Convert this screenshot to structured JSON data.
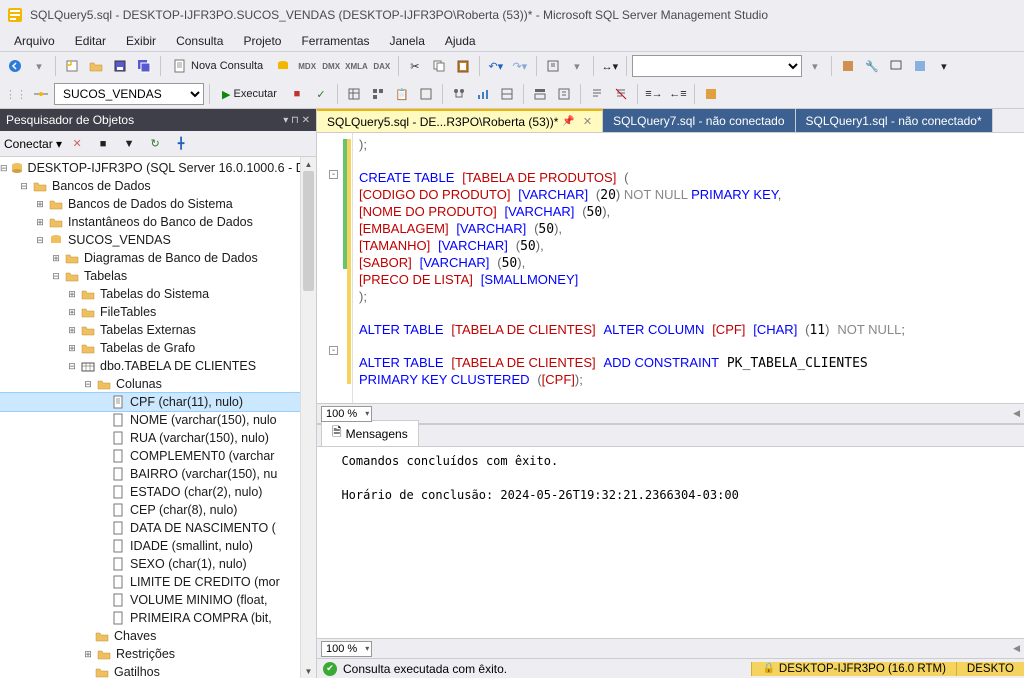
{
  "title": "SQLQuery5.sql - DESKTOP-IJFR3PO.SUCOS_VENDAS (DESKTOP-IJFR3PO\\Roberta (53))* - Microsoft SQL Server Management Studio",
  "menu": [
    "Arquivo",
    "Editar",
    "Exibir",
    "Consulta",
    "Projeto",
    "Ferramentas",
    "Janela",
    "Ajuda"
  ],
  "toolbar": {
    "nova_consulta": "Nova Consulta",
    "executar": "Executar"
  },
  "db_dropdown": "SUCOS_VENDAS",
  "object_explorer": {
    "title": "Pesquisador de Objetos",
    "connect": "Conectar",
    "server": "DESKTOP-IJFR3PO (SQL Server 16.0.1000.6 - DES",
    "bancos": "Bancos de Dados",
    "sys_db": "Bancos de Dados do Sistema",
    "snapshots": "Instantâneos do Banco de Dados",
    "db": "SUCOS_VENDAS",
    "diagramas": "Diagramas de Banco de Dados",
    "tabelas": "Tabelas",
    "tabelas_sistema": "Tabelas do Sistema",
    "filetables": "FileTables",
    "tabelas_externas": "Tabelas Externas",
    "tabelas_grafo": "Tabelas de Grafo",
    "tabela_clientes": "dbo.TABELA DE CLIENTES",
    "colunas": "Colunas",
    "cols": [
      "CPF (char(11), nulo)",
      "NOME (varchar(150), nulo",
      "RUA (varchar(150), nulo)",
      "COMPLEMENT0 (varchar",
      "BAIRRO (varchar(150), nu",
      "ESTADO (char(2), nulo)",
      "CEP (char(8), nulo)",
      "DATA DE NASCIMENTO (",
      "IDADE (smallint, nulo)",
      "SEXO (char(1), nulo)",
      "LIMITE DE CREDITO (mor",
      "VOLUME MINIMO (float,",
      "PRIMEIRA COMPRA (bit,"
    ],
    "chaves": "Chaves",
    "restricoes": "Restrições",
    "gatilhos": "Gatilhos"
  },
  "tabs": [
    {
      "label": "SQLQuery5.sql - DE...R3PO\\Roberta (53))*",
      "active": true,
      "modified": true
    },
    {
      "label": "SQLQuery7.sql - não conectado",
      "active": false
    },
    {
      "label": "SQLQuery1.sql - não conectado*",
      "active": false
    }
  ],
  "sql": {
    "lines": [
      {
        "t": ");",
        "indent": 2
      },
      {
        "t": "",
        "indent": 0
      },
      {
        "type": "create",
        "indent": 0
      },
      {
        "col": "CODIGO DO PRODUTO",
        "vt": "VARCHAR",
        "len": "20",
        "tail": "NOT NULL",
        "pk": true,
        "comma": ","
      },
      {
        "col": "NOME DO PRODUTO",
        "vt": "VARCHAR",
        "len": "50",
        "comma": ","
      },
      {
        "col": "EMBALAGEM",
        "vt": "VARCHAR",
        "len": "50",
        "comma": ","
      },
      {
        "col": "TAMANHO",
        "vt": "VARCHAR",
        "len": "50",
        "comma": ","
      },
      {
        "col": "SABOR",
        "vt": "VARCHAR",
        "len": "50",
        "comma": ","
      },
      {
        "col": "PRECO DE LISTA",
        "vt": "SMALLMONEY"
      },
      {
        "t": ");",
        "indent": 2
      },
      {
        "t": "",
        "indent": 0
      },
      {
        "type": "alter1"
      },
      {
        "t": "",
        "indent": 0
      },
      {
        "type": "alter2a"
      },
      {
        "type": "alter2b"
      }
    ]
  },
  "zoom1": "100 %",
  "messages": {
    "tab": "Mensagens",
    "line1": "Comandos concluídos com êxito.",
    "line2": "Horário de conclusão: 2024-05-26T19:32:21.2366304-03:00"
  },
  "zoom2": "100 %",
  "status": {
    "ok": "Consulta executada com êxito.",
    "server": "DESKTOP-IJFR3PO (16.0 RTM)",
    "user": "DESKTO"
  }
}
